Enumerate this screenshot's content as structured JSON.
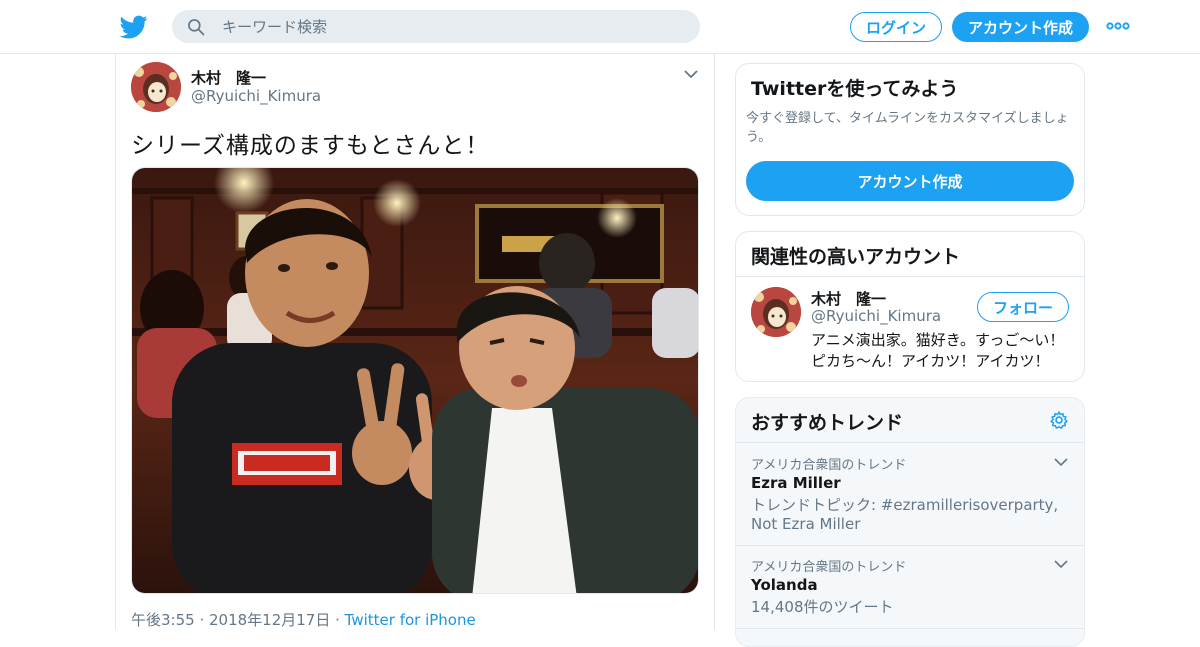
{
  "header": {
    "search_placeholder": "キーワード検索",
    "login_label": "ログイン",
    "signup_label": "アカウント作成"
  },
  "tweet": {
    "author_name": "木村　隆一",
    "author_handle": "@Ryuichi_Kimura",
    "text": "シリーズ構成のますもとさんと！",
    "time": "午後3:55 · 2018年12月17日 · ",
    "source": "Twitter for iPhone"
  },
  "sidebar": {
    "signup_card": {
      "title": "Twitterを使ってみよう",
      "description": "今すぐ登録して、タイムラインをカスタマイズしましょう。",
      "button": "アカウント作成"
    },
    "related": {
      "title": "関連性の高いアカウント",
      "user": {
        "name": "木村　隆一",
        "handle": "@Ryuichi_Kimura",
        "follow_label": "フォロー",
        "bio": "アニメ演出家。猫好き。すっご〜い！ピカち〜ん！アイカツ！アイカツ！"
      }
    },
    "trends": {
      "title": "おすすめトレンド",
      "items": [
        {
          "location": "アメリカ合衆国のトレンド",
          "name": "Ezra Miller",
          "detail": "トレンドトピック: #ezramillerisoverparty, Not Ezra Miller"
        },
        {
          "location": "アメリカ合衆国のトレンド",
          "name": "Yolanda",
          "detail": "14,408件のツイート"
        }
      ]
    }
  },
  "colors": {
    "brand": "#1da1f2",
    "text": "#14171a",
    "secondary": "#657786"
  }
}
